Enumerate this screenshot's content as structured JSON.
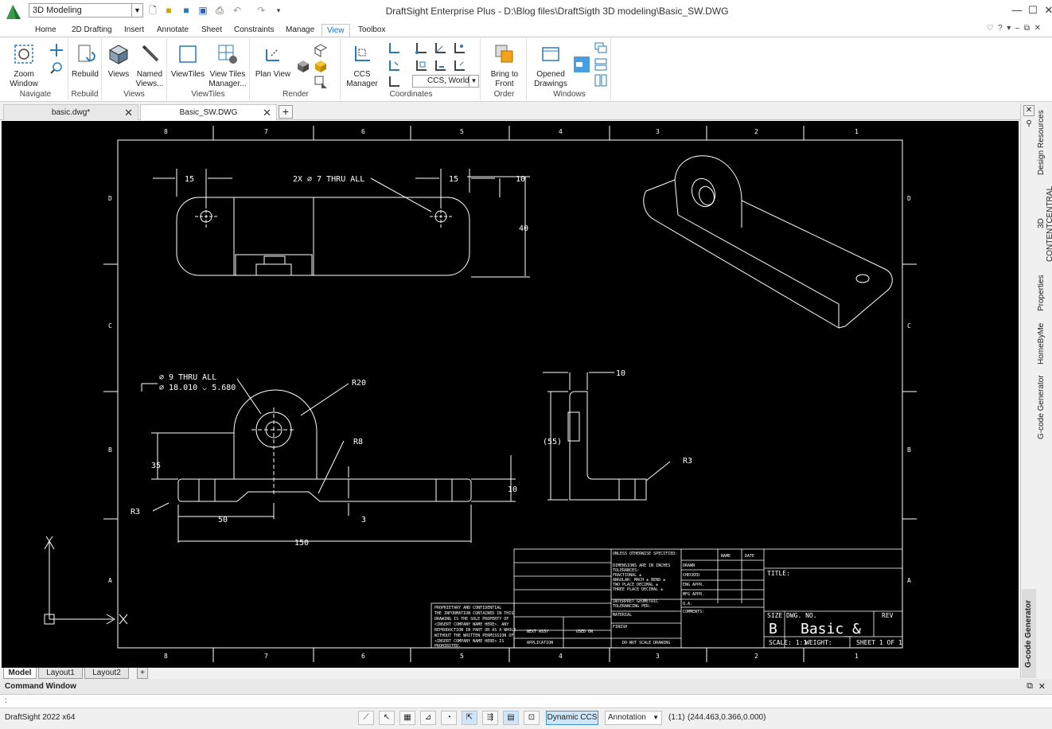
{
  "window": {
    "title": "DraftSight Enterprise Plus - D:\\Blog files\\DraftSigth 3D modeling\\Basic_SW.DWG",
    "workspace": "3D Modeling"
  },
  "ribbon_tabs": [
    "Home",
    "2D Drafting",
    "Insert",
    "Annotate",
    "Sheet",
    "Constraints",
    "Manage",
    "View",
    "Toolbox"
  ],
  "active_tab": "View",
  "ribbon": {
    "navigate": {
      "label": "Navigate",
      "zoom_window": "Zoom\nWindow"
    },
    "rebuild": {
      "label": "Rebuild",
      "button": "Rebuild"
    },
    "views": {
      "label": "Views",
      "views": "Views",
      "named_views": "Named\nViews..."
    },
    "viewtiles": {
      "label": "ViewTiles",
      "viewtiles": "ViewTiles",
      "manager": "View Tiles\nManager..."
    },
    "render": {
      "label": "Render",
      "plan_view": "Plan View"
    },
    "coordinates": {
      "label": "Coordinates",
      "ccs_manager": "CCS\nManager",
      "ccs_select": "CCS, World"
    },
    "order": {
      "label": "Order",
      "bring_front": "Bring to\nFront"
    },
    "windows": {
      "label": "Windows",
      "opened_drawings": "Opened\nDrawings"
    }
  },
  "doc_tabs": [
    {
      "label": "basic.dwg*",
      "active": false
    },
    {
      "label": "Basic_SW.DWG",
      "active": true
    }
  ],
  "layout_tabs": [
    "Model",
    "Layout1",
    "Layout2"
  ],
  "palette_tabs": [
    "Design Resources",
    "3D CONTENTCENTRAL",
    "Properties",
    "HomeByMe",
    "G-code Generator"
  ],
  "gcode_panel": "G-code Generator",
  "command_window": {
    "title": "Command Window",
    "prompt": ":"
  },
  "status": {
    "product": "DraftSight 2022 x64",
    "dynamic_ccs": "Dynamic CCS",
    "annotation": "Annotation",
    "scale": "(1:1)",
    "coords": "(244.463,0.366,0.000)"
  },
  "drawing": {
    "border_cols_top": [
      "8",
      "7",
      "6",
      "5",
      "4",
      "3",
      "2",
      "1"
    ],
    "border_rows": [
      "D",
      "C",
      "B",
      "A"
    ],
    "dims": {
      "d15a": "15",
      "hole_note": "2X ⌀ 7 THRU ALL",
      "d15b": "15",
      "d10a": "10",
      "d40": "40",
      "hole_note2a": "⌀ 9 THRU ALL",
      "hole_note2b": "⌀ 18.010 ⌵ 5.680",
      "r20": "R20",
      "r8": "R8",
      "d35": "35",
      "r3a": "R3",
      "d50": "50",
      "d3": "3",
      "d10b": "10",
      "d150": "150",
      "d10c": "10",
      "d55": "(55)",
      "r3b": "R3"
    },
    "title_block": {
      "size_label": "SIZE",
      "size": "B",
      "dwg_no_label": "DWG. NO.",
      "dwg_no": "Basic_&",
      "rev": "REV",
      "scale": "SCALE: 1:1",
      "weight": "WEIGHT:",
      "sheet": "SHEET 1 OF 1",
      "title": "TITLE:",
      "name": "NAME",
      "date": "DATE",
      "drawn": "DRAWN",
      "checked": "CHECKED",
      "eng_appr": "ENG APPR.",
      "mfg_appr": "MFG APPR.",
      "qa": "Q.A.",
      "comments": "COMMENTS:",
      "tolerance": [
        "UNLESS OTHERWISE SPECIFIED:",
        "DIMENSIONS ARE IN INCHES",
        "TOLERANCES:",
        "FRACTIONAL ±",
        "ANGULAR: MACH ±  BEND ±",
        "TWO PLACE DECIMAL  ±",
        "THREE PLACE DECIMAL  ±"
      ],
      "interpret": [
        "INTERPRET GEOMETRIC",
        "TOLERANCING PER:"
      ],
      "material": "MATERIAL",
      "finish": "FINISH",
      "next_assy": "NEXT ASSY",
      "used_on": "USED ON",
      "application": "APPLICATION",
      "do_not_scale": "DO NOT SCALE DRAWING",
      "proprietary": [
        "PROPRIETARY AND CONFIDENTIAL",
        "THE INFORMATION CONTAINED IN THIS",
        "DRAWING IS THE SOLE PROPERTY OF",
        "<INSERT COMPANY NAME HERE>. ANY",
        "REPRODUCTION IN PART OR AS A WHOLE",
        "WITHOUT THE WRITTEN PERMISSION OF",
        "<INSERT COMPANY NAME HERE> IS",
        "PROHIBITED."
      ]
    }
  }
}
